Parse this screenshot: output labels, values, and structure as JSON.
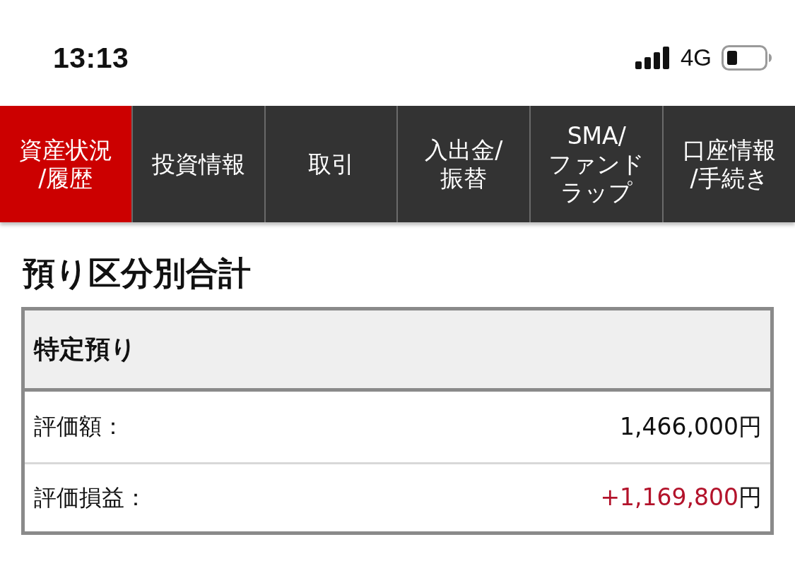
{
  "status_bar": {
    "time": "13:13",
    "network": "4G"
  },
  "nav_tabs": [
    {
      "lines": [
        "資産状況",
        "/履歴"
      ],
      "selected": true
    },
    {
      "lines": [
        "投資情報"
      ],
      "selected": false
    },
    {
      "lines": [
        "取引"
      ],
      "selected": false
    },
    {
      "lines": [
        "入出金/",
        "振替"
      ],
      "selected": false
    },
    {
      "lines": [
        "SMA/",
        "ファンド",
        "ラップ"
      ],
      "selected": false
    },
    {
      "lines": [
        "口座情報",
        "/手続き"
      ],
      "selected": false
    }
  ],
  "section": {
    "title": "預り区分別合計",
    "table": {
      "header": "特定預り",
      "rows": [
        {
          "kind": "plain",
          "label": "評価額：",
          "value": "1,466,000",
          "unit": "円"
        },
        {
          "kind": "gain",
          "label": "評価損益：",
          "value": "+1,169,800",
          "unit": "円"
        }
      ]
    }
  }
}
